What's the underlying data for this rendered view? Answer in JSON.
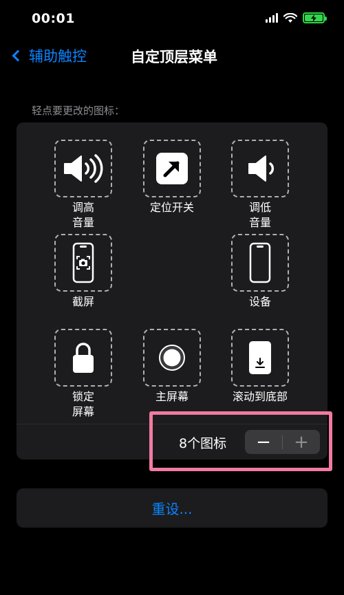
{
  "status_bar": {
    "time": "00:01"
  },
  "nav": {
    "back_label": "辅助触控",
    "title": "自定顶层菜单"
  },
  "hint": "轻点要更改的图标：",
  "slots": [
    {
      "label": "调高\n音量",
      "icon": "volume-up-icon"
    },
    {
      "label": "定位开关",
      "icon": "point-switch-icon"
    },
    {
      "label": "调低\n音量",
      "icon": "volume-down-icon"
    },
    {
      "label": "截屏",
      "icon": "screenshot-icon"
    },
    {
      "label": "设备",
      "icon": "device-icon"
    },
    {
      "label": "锁定\n屏幕",
      "icon": "lock-icon"
    },
    {
      "label": "主屏幕",
      "icon": "home-icon"
    },
    {
      "label": "滚动到底部",
      "icon": "scroll-to-bottom-icon"
    }
  ],
  "icon_count": {
    "label": "8个图标",
    "minus": "−",
    "plus": "+"
  },
  "reset_label": "重设...",
  "colors": {
    "accent": "#0a84ff",
    "highlight": "#f07ba1",
    "battery": "#32d74b",
    "panel": "#1c1c1e"
  }
}
